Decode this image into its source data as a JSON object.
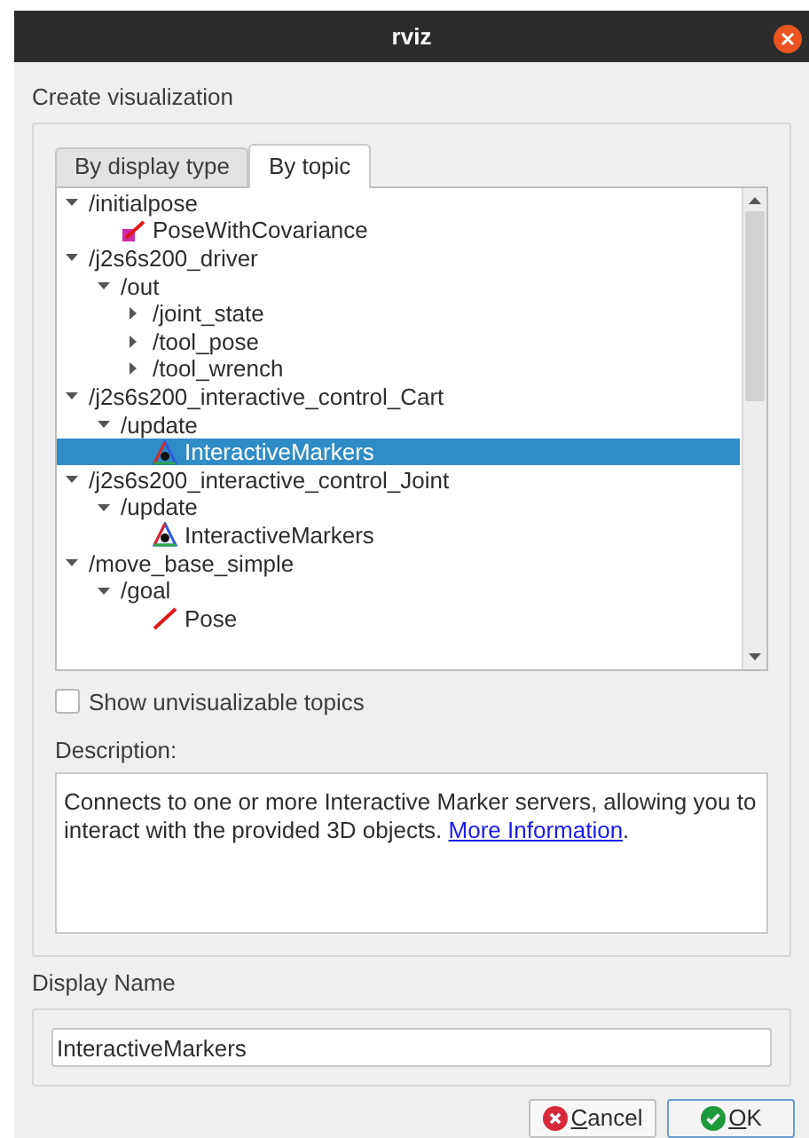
{
  "window": {
    "title": "rviz"
  },
  "heading": "Create visualization",
  "tabs": [
    {
      "label": "By display type",
      "selected": false
    },
    {
      "label": "By topic",
      "selected": true
    }
  ],
  "tree": [
    {
      "label": "/initialpose",
      "kind": "topic",
      "expanded": true,
      "selected": false,
      "children": [
        {
          "label": "PoseWithCovariance",
          "kind": "pose_covariance",
          "selected": false
        }
      ]
    },
    {
      "label": "/j2s6s200_driver",
      "kind": "topic",
      "expanded": true,
      "selected": false,
      "children": [
        {
          "label": "/out",
          "kind": "topic",
          "expanded": true,
          "selected": false,
          "children": [
            {
              "label": "/joint_state",
              "kind": "topic",
              "expanded": false,
              "selected": false
            },
            {
              "label": "/tool_pose",
              "kind": "topic",
              "expanded": false,
              "selected": false
            },
            {
              "label": "/tool_wrench",
              "kind": "topic",
              "expanded": false,
              "selected": false
            }
          ]
        }
      ]
    },
    {
      "label": "/j2s6s200_interactive_control_Cart",
      "kind": "topic",
      "expanded": true,
      "selected": false,
      "children": [
        {
          "label": "/update",
          "kind": "topic",
          "expanded": true,
          "selected": false,
          "children": [
            {
              "label": "InteractiveMarkers",
              "kind": "interactive_markers",
              "selected": true
            }
          ]
        }
      ]
    },
    {
      "label": "/j2s6s200_interactive_control_Joint",
      "kind": "topic",
      "expanded": true,
      "selected": false,
      "children": [
        {
          "label": "/update",
          "kind": "topic",
          "expanded": true,
          "selected": false,
          "children": [
            {
              "label": "InteractiveMarkers",
              "kind": "interactive_markers",
              "selected": false
            }
          ]
        }
      ]
    },
    {
      "label": "/move_base_simple",
      "kind": "topic",
      "expanded": true,
      "selected": false,
      "children": [
        {
          "label": "/goal",
          "kind": "topic",
          "expanded": true,
          "selected": false,
          "children": [
            {
              "label": "Pose",
              "kind": "pose",
              "selected": false
            }
          ]
        }
      ]
    }
  ],
  "show_unvisualizable": {
    "label": "Show unvisualizable topics",
    "checked": false
  },
  "description": {
    "label": "Description:",
    "text": "Connects to one or more Interactive Marker servers, allowing you to interact with the provided 3D objects.",
    "link": "More Information",
    "after": "."
  },
  "display_name": {
    "label": "Display Name",
    "value": "InteractiveMarkers"
  },
  "buttons": [
    {
      "label": "Cancel",
      "kind": "cancel"
    },
    {
      "label": "OK",
      "kind": "ok"
    }
  ]
}
